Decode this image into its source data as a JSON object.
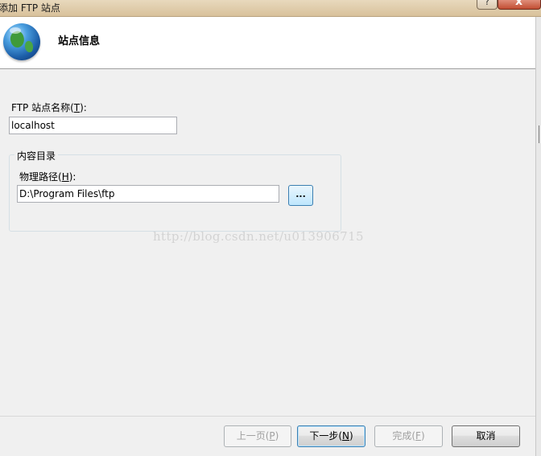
{
  "window": {
    "title": "添加 FTP 站点",
    "help_glyph": "?",
    "close_glyph": "x"
  },
  "header": {
    "title": "站点信息",
    "icon": "globe-icon"
  },
  "form": {
    "site_name_label_prefix": "FTP 站点名称(",
    "site_name_label_key": "T",
    "site_name_label_suffix": "):",
    "site_name_value": "localhost",
    "content_dir_legend": "内容目录",
    "physical_path_label_prefix": "物理路径(",
    "physical_path_label_key": "H",
    "physical_path_label_suffix": "):",
    "physical_path_value": "D:\\Program Files\\ftp",
    "browse_label": "..."
  },
  "watermark": "http://blog.csdn.net/u013906715",
  "footer": {
    "prev": {
      "prefix": "上一页(",
      "key": "P",
      "suffix": ")"
    },
    "next": {
      "prefix": "下一步(",
      "key": "N",
      "suffix": ")"
    },
    "finish": {
      "prefix": "完成(",
      "key": "F",
      "suffix": ")"
    },
    "cancel": "取消"
  }
}
